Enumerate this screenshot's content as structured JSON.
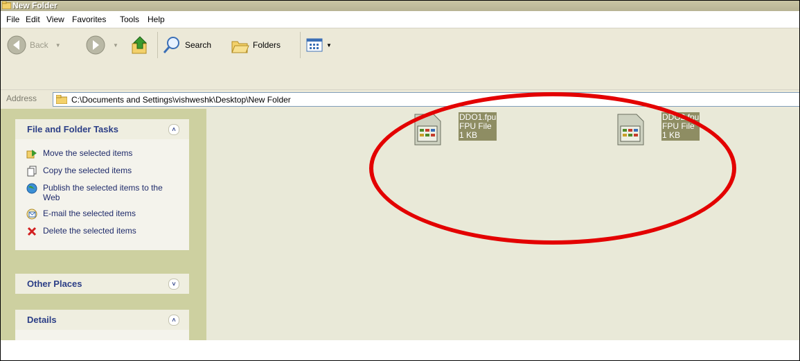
{
  "window": {
    "title": "New Folder"
  },
  "menu": [
    "File",
    "Edit",
    "View",
    "Favorites",
    "Tools",
    "Help"
  ],
  "toolbar": {
    "back_label": "Back",
    "search_label": "Search",
    "folders_label": "Folders"
  },
  "address": {
    "label": "Address",
    "path": "C:\\Documents and Settings\\vishweshk\\Desktop\\New Folder"
  },
  "sidebar": {
    "file_tasks": {
      "title": "File and Folder Tasks",
      "items": [
        "Move the selected items",
        "Copy the selected items",
        "Publish the selected items to the Web",
        "E-mail the selected items",
        "Delete the selected items"
      ]
    },
    "other_places": {
      "title": "Other Places"
    },
    "details": {
      "title": "Details"
    }
  },
  "files": [
    {
      "name": "DDO1.fpu",
      "type": "FPU File",
      "size": "1 KB"
    },
    {
      "name": "DDO2.fpu",
      "type": "FPU File",
      "size": "1 KB"
    }
  ],
  "colors": {
    "annotation": "#e30000",
    "selection": "#8e8d63"
  }
}
